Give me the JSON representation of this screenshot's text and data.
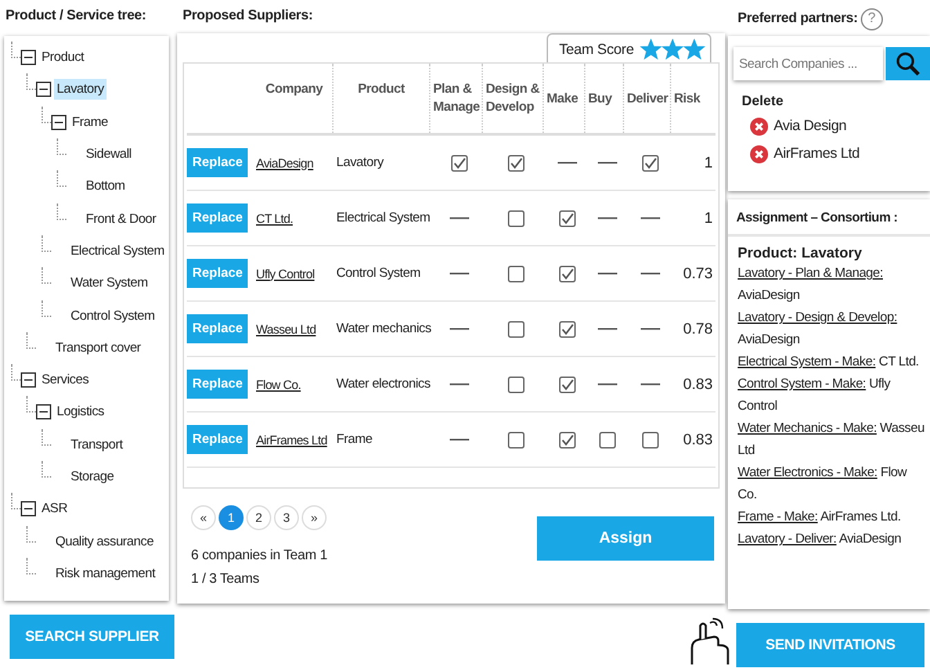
{
  "tree": {
    "title": "Product / Service tree:",
    "items": [
      {
        "label": "Product",
        "expanded": true,
        "selected": false,
        "children": [
          {
            "label": "Lavatory",
            "expanded": true,
            "selected": true,
            "children": [
              {
                "label": "Frame",
                "expanded": true,
                "selected": false,
                "children": [
                  {
                    "label": "Sidewall",
                    "selected": false
                  },
                  {
                    "label": "Bottom",
                    "selected": false
                  },
                  {
                    "label": "Front & Door",
                    "selected": false
                  }
                ]
              },
              {
                "label": "Electrical System",
                "selected": false
              },
              {
                "label": "Water System",
                "selected": false
              },
              {
                "label": "Control System",
                "selected": false
              }
            ]
          },
          {
            "label": "Transport cover",
            "selected": false
          }
        ]
      },
      {
        "label": "Services",
        "expanded": true,
        "selected": false,
        "children": [
          {
            "label": "Logistics",
            "expanded": true,
            "selected": false,
            "children": [
              {
                "label": "Transport",
                "selected": false
              },
              {
                "label": "Storage",
                "selected": false
              }
            ]
          }
        ]
      },
      {
        "label": "ASR",
        "expanded": true,
        "selected": false,
        "children": [
          {
            "label": "Quality assurance",
            "selected": false
          },
          {
            "label": "Risk management",
            "selected": false
          }
        ]
      }
    ]
  },
  "search_supplier_button": "SEARCH SUPPLIER",
  "suppliers": {
    "title": "Proposed Suppliers:",
    "team_score": {
      "label": "Team Score",
      "stars": 3
    },
    "columns": [
      "Company",
      "Product",
      "Plan & Manage",
      "Design & Develop",
      "Make",
      "Buy",
      "Deliver",
      "Risk"
    ],
    "rows": [
      {
        "action": "Replace",
        "company": "AviaDesign",
        "product": "Lavatory",
        "roles": [
          {
            "kind": "box",
            "checked": true
          },
          {
            "kind": "box",
            "checked": true
          },
          {
            "kind": "dash"
          },
          {
            "kind": "dash"
          },
          {
            "kind": "box",
            "checked": true
          }
        ],
        "risk": "1"
      },
      {
        "action": "Replace",
        "company": "CT Ltd.",
        "product": "Electrical System",
        "roles": [
          {
            "kind": "dash"
          },
          {
            "kind": "box",
            "checked": false
          },
          {
            "kind": "box",
            "checked": true
          },
          {
            "kind": "dash"
          },
          {
            "kind": "dash"
          }
        ],
        "risk": "1"
      },
      {
        "action": "Replace",
        "company": "Ufly Control",
        "product": "Control System",
        "roles": [
          {
            "kind": "dash"
          },
          {
            "kind": "box",
            "checked": false
          },
          {
            "kind": "box",
            "checked": true
          },
          {
            "kind": "dash"
          },
          {
            "kind": "dash"
          }
        ],
        "risk": "0.73"
      },
      {
        "action": "Replace",
        "company": "Wasseu  Ltd",
        "product": "Water mechanics",
        "roles": [
          {
            "kind": "dash"
          },
          {
            "kind": "box",
            "checked": false
          },
          {
            "kind": "box",
            "checked": true
          },
          {
            "kind": "dash"
          },
          {
            "kind": "dash"
          }
        ],
        "risk": "0.78"
      },
      {
        "action": "Replace",
        "company": "Flow Co.",
        "product": "Water electronics",
        "roles": [
          {
            "kind": "dash"
          },
          {
            "kind": "box",
            "checked": false
          },
          {
            "kind": "box",
            "checked": true
          },
          {
            "kind": "dash"
          },
          {
            "kind": "dash"
          }
        ],
        "risk": "0.83"
      },
      {
        "action": "Replace",
        "company": "AirFrames Ltd",
        "product": "Frame",
        "roles": [
          {
            "kind": "dash"
          },
          {
            "kind": "box",
            "checked": false
          },
          {
            "kind": "box",
            "checked": true
          },
          {
            "kind": "box",
            "checked": false
          },
          {
            "kind": "box",
            "checked": false
          }
        ],
        "risk": "0.83"
      }
    ],
    "pagination": {
      "prev": "«",
      "next": "»",
      "pages": [
        {
          "label": "1",
          "selected": true
        },
        {
          "label": "2",
          "selected": false
        },
        {
          "label": "3",
          "selected": false
        }
      ]
    },
    "assign_button": "Assign",
    "summary": [
      "6 companies in Team 1",
      "1 / 3 Teams"
    ]
  },
  "partners": {
    "title": "Preferred partners:",
    "help": "?",
    "search": {
      "placeholder": "Search Companies ..."
    },
    "delete_label": "Delete",
    "items": [
      "Avia Design",
      "AirFrames Ltd"
    ]
  },
  "assignment": {
    "title": "Assignment – Consortium :",
    "heading": "Product: Lavatory",
    "entries": [
      {
        "task": "Lavatory - Plan & Manage:",
        "company": "AviaDesign"
      },
      {
        "task": "Lavatory - Design & Develop:",
        "company": "AviaDesign"
      },
      {
        "task": "Electrical System - Make:",
        "company": "CT Ltd."
      },
      {
        "task": "Control System - Make:",
        "company": "Ufly Control"
      },
      {
        "task": "Water Mechanics - Make:",
        "company": "Wasseu Ltd"
      },
      {
        "task": "Water Electronics - Make:",
        "company": "Flow Co."
      },
      {
        "task": "Frame - Make:",
        "company": "AirFrames  Ltd."
      },
      {
        "task": "Lavatory - Deliver:",
        "company": "AviaDesign"
      }
    ]
  },
  "send_invitations_button": "SEND INVITATIONS"
}
